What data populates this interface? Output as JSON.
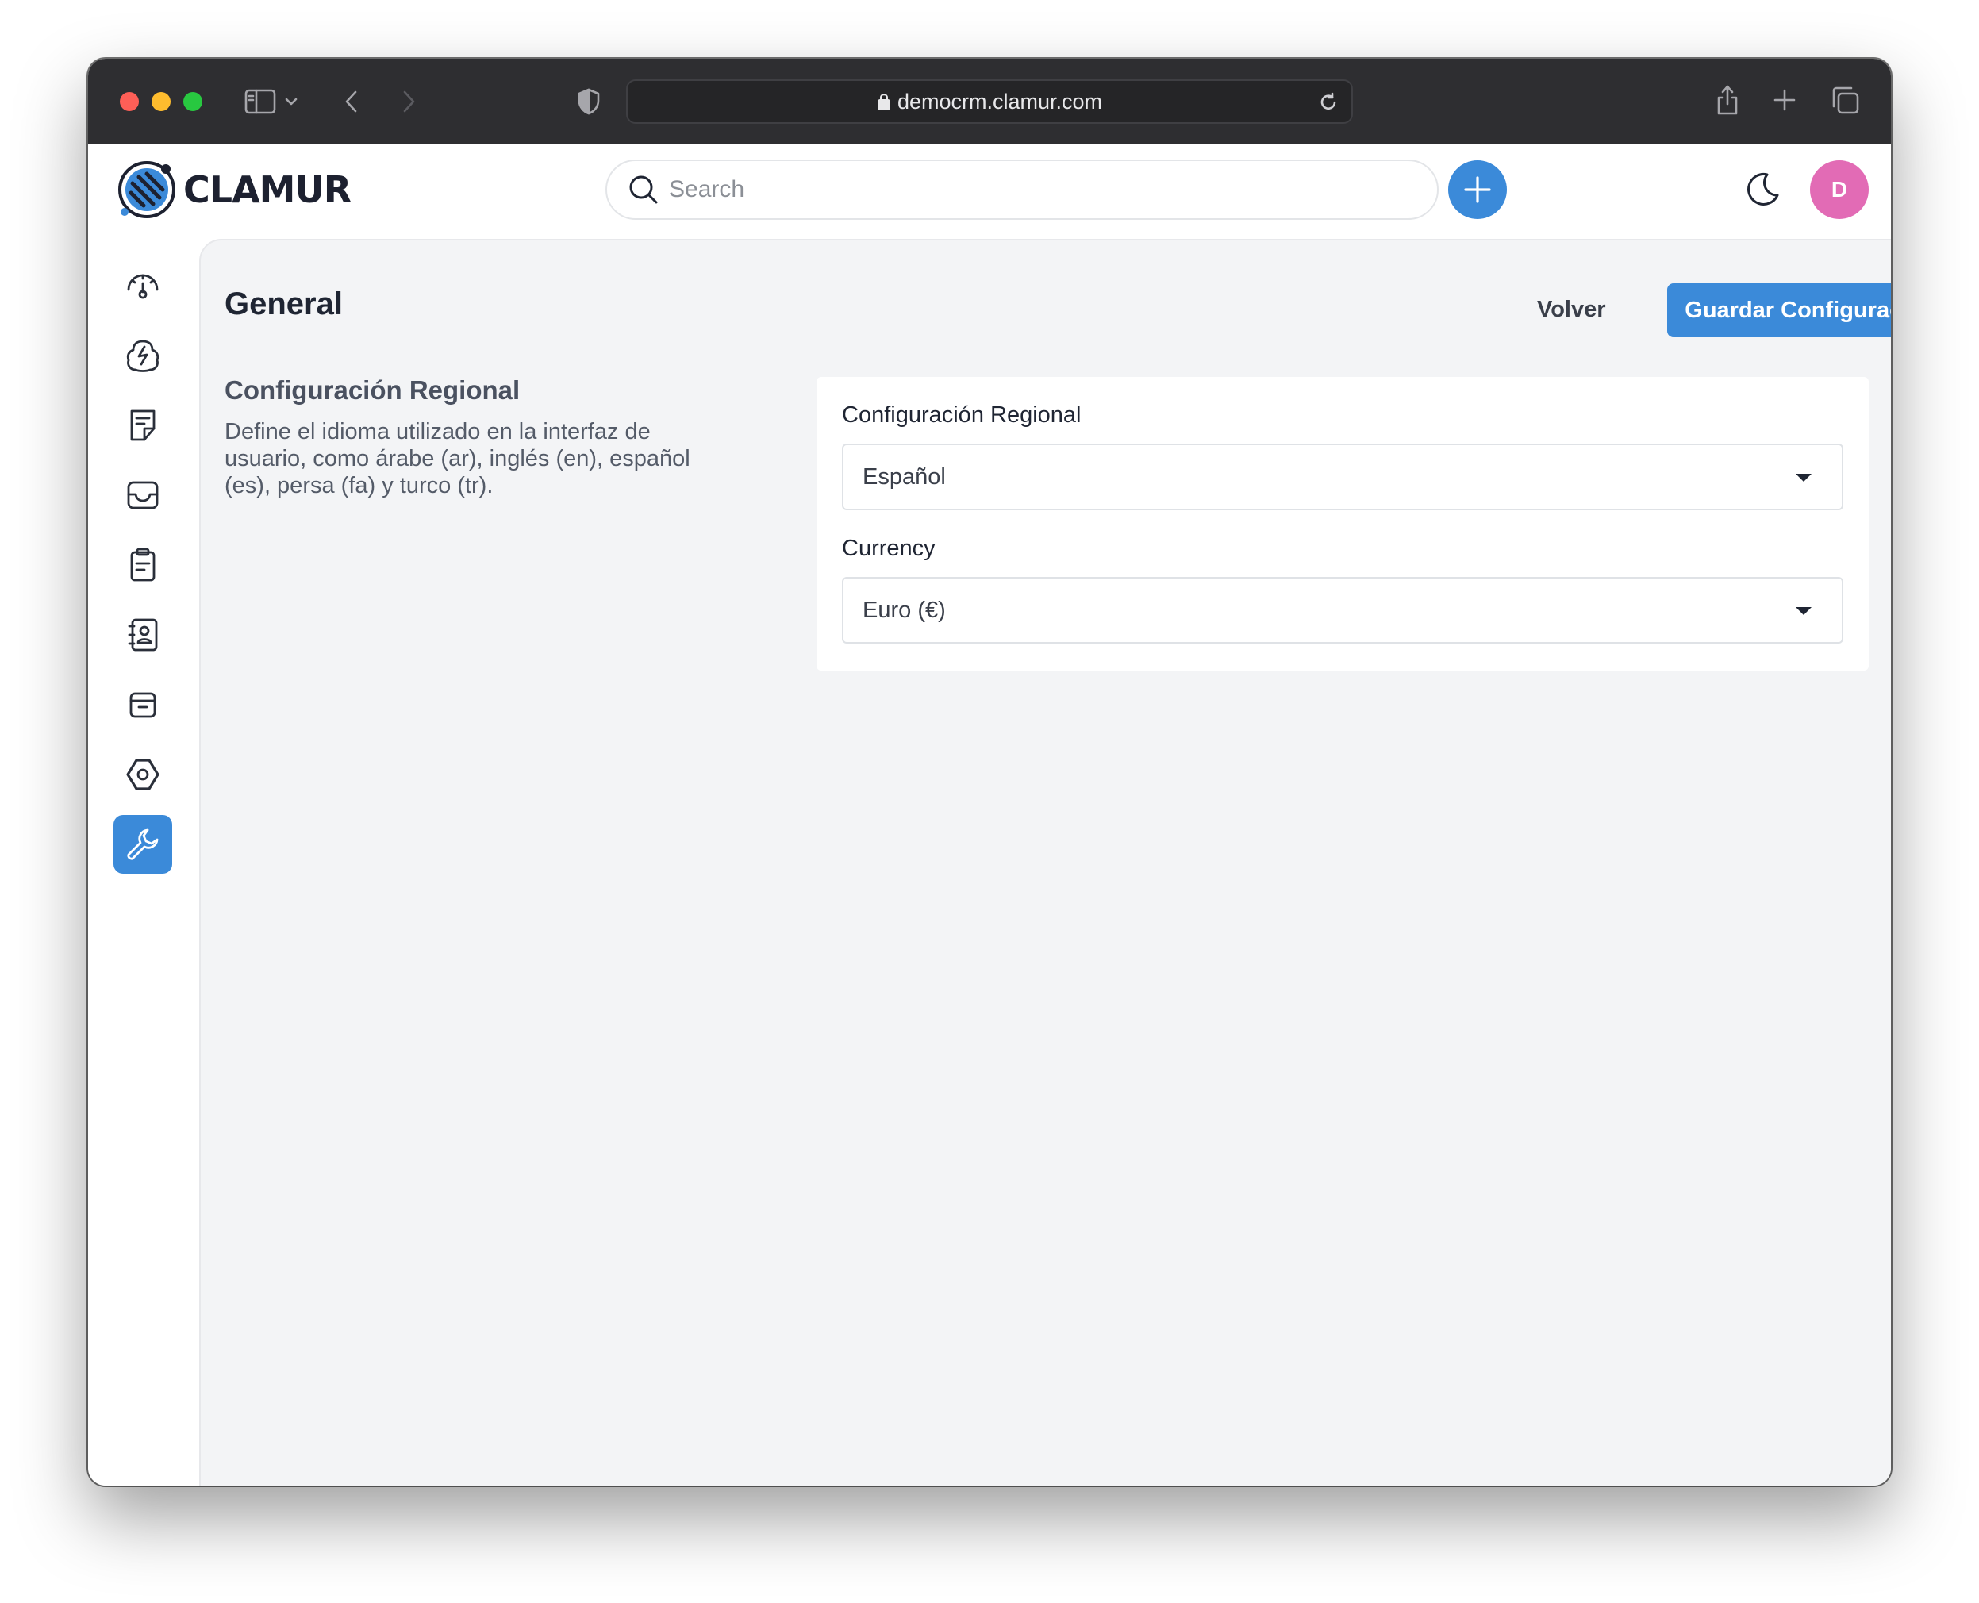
{
  "browser": {
    "url": "democrm.clamur.com"
  },
  "header": {
    "logo_text": "CLAMUR",
    "search_placeholder": "Search",
    "avatar_initial": "D"
  },
  "sidebar": {
    "items": [
      {
        "icon": "dashboard-gauge-icon",
        "active": false
      },
      {
        "icon": "activity-bolt-icon",
        "active": false
      },
      {
        "icon": "note-icon",
        "active": false
      },
      {
        "icon": "inbox-icon",
        "active": false
      },
      {
        "icon": "clipboard-icon",
        "active": false
      },
      {
        "icon": "contacts-book-icon",
        "active": false
      },
      {
        "icon": "archive-icon",
        "active": false
      },
      {
        "icon": "hexagon-settings-icon",
        "active": false
      },
      {
        "icon": "wrench-icon",
        "active": true
      }
    ]
  },
  "main": {
    "title": "General",
    "back_label": "Volver",
    "save_label": "Guardar Configuración",
    "section_title": "Configuración Regional",
    "section_description": "Define el idioma utilizado en la interfaz de usuario, como árabe (ar), inglés (en), español (es), persa (fa) y turco (tr).",
    "fields": {
      "locale": {
        "label": "Configuración Regional",
        "value": "Español"
      },
      "currency": {
        "label": "Currency",
        "value": "Euro (€)"
      }
    }
  },
  "colors": {
    "accent": "#3b8ad9",
    "avatar": "#e26bb5",
    "chrome": "#2e2e31",
    "main_bg": "#f3f4f6"
  }
}
